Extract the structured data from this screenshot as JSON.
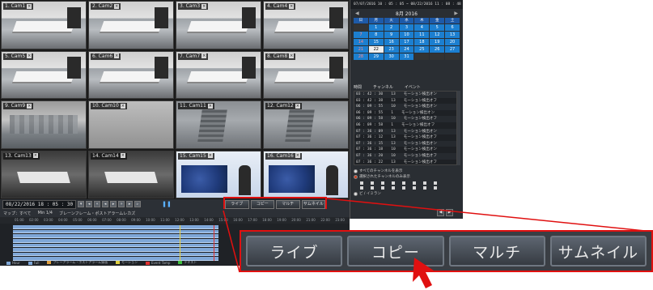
{
  "cameras": [
    {
      "label": "1. Cam1",
      "scene": "office"
    },
    {
      "label": "2. Cam2",
      "scene": "office"
    },
    {
      "label": "3. Cam3",
      "scene": "office"
    },
    {
      "label": "4. Cam4",
      "scene": "office"
    },
    {
      "label": "5. Cam5",
      "scene": "office"
    },
    {
      "label": "6. Cam6",
      "scene": "office"
    },
    {
      "label": "7. Cam7",
      "scene": "office"
    },
    {
      "label": "8. Cam8",
      "scene": "office"
    },
    {
      "label": "9. Cam9",
      "scene": "city"
    },
    {
      "label": "10. Cam10",
      "scene": "fog"
    },
    {
      "label": "11. Cam11",
      "scene": "tower"
    },
    {
      "label": "12. Cam12",
      "scene": "tower"
    },
    {
      "label": "13. Cam13",
      "scene": "room"
    },
    {
      "label": "14. Cam14",
      "scene": "room"
    },
    {
      "label": "15. Cam15",
      "scene": "tv"
    },
    {
      "label": "16. Cam16",
      "scene": "tv"
    }
  ],
  "playbar": {
    "datetime": "08/22/2016 18 : 05 : 30",
    "pause_icon": "❚❚"
  },
  "mini_toolbar": [
    "ライブ",
    "コピー",
    "マルチ",
    "サムネイル"
  ],
  "timeline": {
    "header": [
      "マップ：すべて",
      "Min  1/4",
      "ブレーンフレーム・ポストアラームレカズ"
    ],
    "hours": [
      "01:00",
      "02:00",
      "03:00",
      "04:00",
      "05:00",
      "06:00",
      "07:00",
      "08:00",
      "09:00",
      "10:00",
      "11:00",
      "12:00",
      "13:00",
      "14:00",
      "15:00",
      "16:00",
      "17:00",
      "18:00",
      "19:00",
      "20:00",
      "21:00",
      "22:00",
      "23:00"
    ],
    "track_count": 8,
    "legend": [
      {
        "label": "Hour",
        "color": "#7fa7d8"
      },
      {
        "label": "Full",
        "color": "#7fa7d8"
      },
      {
        "label": "プレーアラーム・ポストアラーム録画",
        "color": "#e0a040"
      },
      {
        "label": "モーション",
        "color": "#e0d040"
      },
      {
        "label": "Event Tamp",
        "color": "#e03030"
      },
      {
        "label": "テキスト",
        "color": "#40c040"
      }
    ]
  },
  "right_panel": {
    "range": "07/07/2016 10 : 05 : 05 ~ 08/22/2016 11 : 08 : 48",
    "month_label": "8月  2016",
    "prev_arrow": "◀",
    "next_arrow": "▶",
    "weekdays": [
      "日",
      "月",
      "火",
      "水",
      "木",
      "金",
      "土"
    ],
    "days": [
      "",
      "1",
      "2",
      "3",
      "4",
      "5",
      "6",
      "7",
      "8",
      "9",
      "10",
      "11",
      "12",
      "13",
      "14",
      "15",
      "16",
      "17",
      "18",
      "19",
      "20",
      "21",
      "22",
      "23",
      "24",
      "25",
      "26",
      "27",
      "28",
      "29",
      "30",
      "31",
      "",
      "",
      ""
    ],
    "selected_day": "22",
    "event_headers": [
      "時間",
      "チャンネル",
      "イベント"
    ],
    "events": [
      [
        "03 : 42 : 30",
        "13",
        "モーション検出オン"
      ],
      [
        "03 : 42 : 38",
        "13",
        "モーション検出オフ"
      ],
      [
        "06 : 09 : 55",
        "10",
        "モーション検出オン"
      ],
      [
        "06 : 09 : 55",
        "1",
        "モーション検出オン"
      ],
      [
        "06 : 09 : 58",
        "10",
        "モーション検出オフ"
      ],
      [
        "06 : 09 : 58",
        "1",
        "モーション検出オフ"
      ],
      [
        "07 : 36 : 09",
        "13",
        "モーション検出オン"
      ],
      [
        "07 : 36 : 12",
        "13",
        "モーション検出オフ"
      ],
      [
        "07 : 36 : 15",
        "13",
        "モーション検出オン"
      ],
      [
        "07 : 36 : 18",
        "10",
        "モーション検出オン"
      ],
      [
        "07 : 36 : 20",
        "10",
        "モーション検出オフ"
      ],
      [
        "07 : 36 : 22",
        "13",
        "モーション検出オフ"
      ]
    ],
    "options": [
      {
        "label": "すべてのチャンネルを表示",
        "on": false
      },
      {
        "label": "選択されたチャンネルのみ表示",
        "on": true
      }
    ],
    "channel_checkbox_count": 16,
    "sub_option": "ビ / イミラン"
  },
  "pager": {
    "prev": "◀",
    "next": "▶"
  },
  "zoom_buttons": [
    "ライブ",
    "コピー",
    "マルチ",
    "サムネイル"
  ]
}
